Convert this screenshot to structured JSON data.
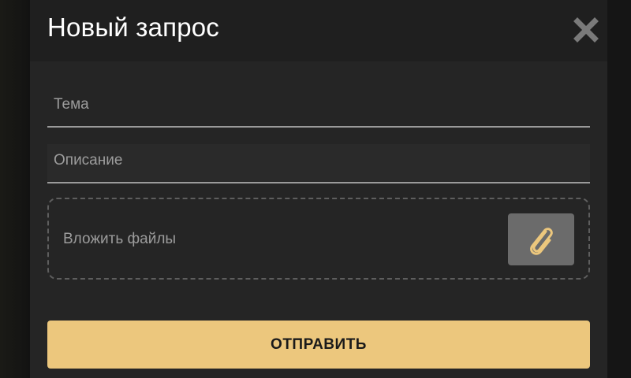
{
  "modal": {
    "title": "Новый запрос",
    "close_icon": "close-icon"
  },
  "form": {
    "subject_placeholder": "Тема",
    "subject_value": "",
    "description_placeholder": "Описание",
    "description_value": "",
    "attach_label": "Вложить файлы",
    "attach_icon": "paperclip-icon",
    "submit_label": "ОТПРАВИТЬ"
  },
  "colors": {
    "modal_background": "#252525",
    "header_background": "#1f1f1f",
    "accent": "#ecc77d",
    "attach_button_background": "#6b6b6b",
    "field_underline": "#9a9a9a"
  }
}
